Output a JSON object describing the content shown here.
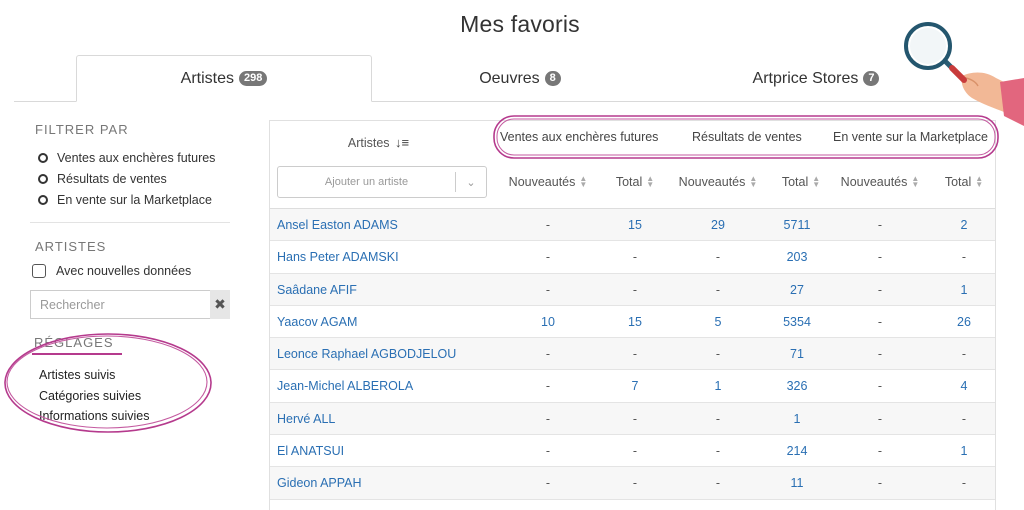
{
  "page_title": "Mes favoris",
  "tabs": [
    {
      "label": "Artistes",
      "badge": "298"
    },
    {
      "label": "Oeuvres",
      "badge": "8"
    },
    {
      "label": "Artprice Stores",
      "badge": "7"
    }
  ],
  "filter": {
    "heading": "FILTRER PAR",
    "options": [
      "Ventes aux enchères futures",
      "Résultats de ventes",
      "En vente sur la Marketplace"
    ]
  },
  "artists_panel": {
    "heading": "ARTISTES",
    "checkbox_label": "Avec nouvelles données",
    "search_placeholder": "Rechercher",
    "clear_glyph": "✖"
  },
  "settings": {
    "heading": "RÉGLAGES",
    "links": [
      "Artistes suivis",
      "Catégories suivies",
      "Informations suivies"
    ]
  },
  "table": {
    "artist_col_label": "Artistes",
    "sort_icon": "↓≡",
    "add_artist_placeholder": "Ajouter un artiste",
    "groups": [
      "Ventes aux enchères futures",
      "Résultats de ventes",
      "En vente sur la Marketplace"
    ],
    "subcolumns": [
      "Nouveautés",
      "Total",
      "Nouveautés",
      "Total",
      "Nouveautés",
      "Total"
    ],
    "rows": [
      {
        "name": "Ansel Easton ADAMS",
        "values": [
          "-",
          "15",
          "29",
          "5711",
          "-",
          "2"
        ]
      },
      {
        "name": "Hans Peter ADAMSKI",
        "values": [
          "-",
          "-",
          "-",
          "203",
          "-",
          "-"
        ]
      },
      {
        "name": "Saâdane AFIF",
        "values": [
          "-",
          "-",
          "-",
          "27",
          "-",
          "1"
        ]
      },
      {
        "name": "Yaacov AGAM",
        "values": [
          "10",
          "15",
          "5",
          "5354",
          "-",
          "26"
        ]
      },
      {
        "name": "Leonce Raphael AGBODJELOU",
        "values": [
          "-",
          "-",
          "-",
          "71",
          "-",
          "-"
        ]
      },
      {
        "name": "Jean-Michel ALBEROLA",
        "values": [
          "-",
          "7",
          "1",
          "326",
          "-",
          "4"
        ]
      },
      {
        "name": "Hervé ALL",
        "values": [
          "-",
          "-",
          "-",
          "1",
          "-",
          "-"
        ]
      },
      {
        "name": "El ANATSUI",
        "values": [
          "-",
          "-",
          "-",
          "214",
          "-",
          "1"
        ]
      },
      {
        "name": "Gideon APPAH",
        "values": [
          "-",
          "-",
          "-",
          "11",
          "-",
          "-"
        ]
      }
    ]
  },
  "colors": {
    "accent_link": "#2a6fb3",
    "highlight": "#b53a8d",
    "badge": "#777777"
  }
}
